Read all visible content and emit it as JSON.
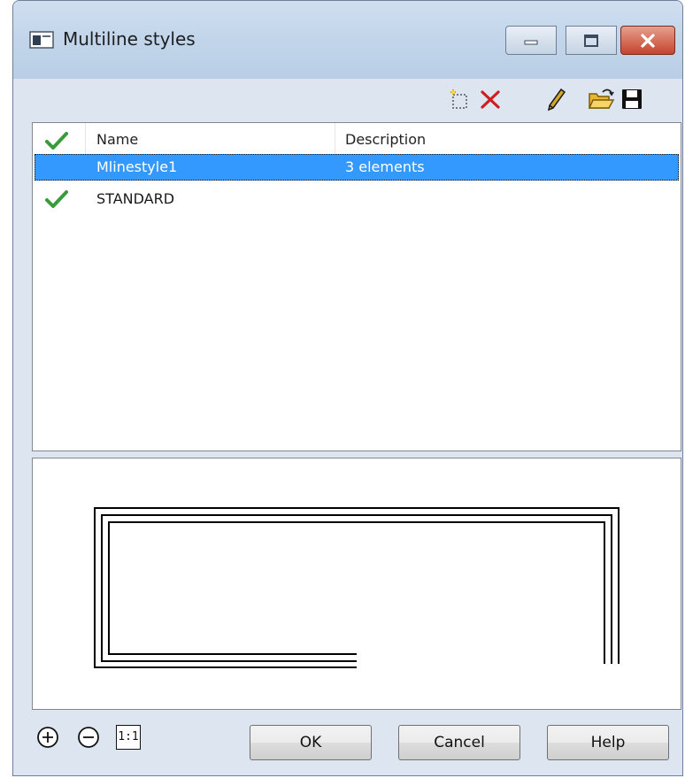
{
  "window": {
    "title": "Multiline styles",
    "accent": "#3399ff"
  },
  "toolbar": {
    "buttons": [
      {
        "icon": "new-style-icon"
      },
      {
        "icon": "delete-icon",
        "color": "#cc1f1f"
      },
      {
        "icon": "pencil-icon"
      },
      {
        "icon": "open-folder-icon",
        "color": "#e8b531"
      },
      {
        "icon": "save-disk-icon"
      }
    ]
  },
  "list": {
    "columns": {
      "current": "",
      "name": "Name",
      "description": "Description"
    },
    "rows": [
      {
        "current": false,
        "name": "Mlinestyle1",
        "description": "3 elements",
        "selected": true
      },
      {
        "current": true,
        "name": "STANDARD",
        "description": "",
        "selected": false
      }
    ]
  },
  "preview": {
    "lines": 3
  },
  "footer": {
    "zoom_in_icon": "zoom-in-icon",
    "zoom_out_icon": "zoom-out-icon",
    "actual_size_label": "1:1",
    "ok_label": "OK",
    "cancel_label": "Cancel",
    "help_label": "Help"
  }
}
